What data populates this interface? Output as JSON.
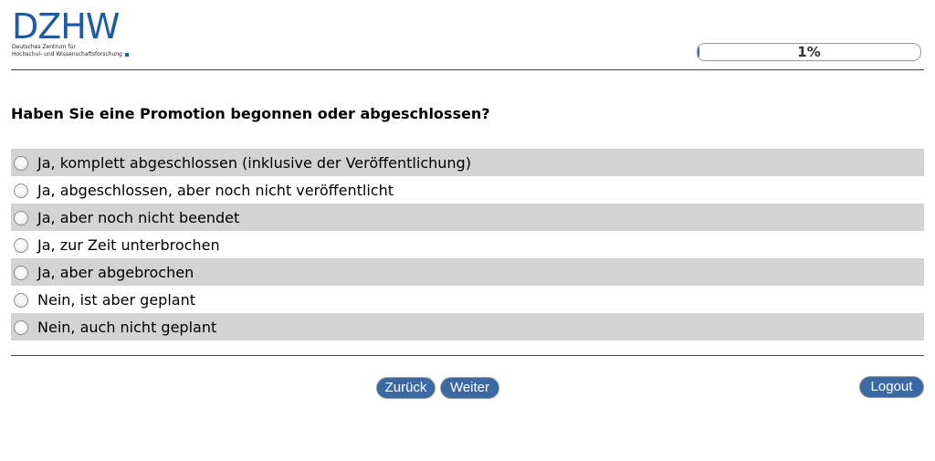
{
  "header": {
    "logo_mark": "DZHW",
    "logo_line1": "Deutsches Zentrum für",
    "logo_line2": "Hochschul- und Wissenschaftsforschung",
    "progress_text": "1%",
    "progress_fraction": 0.01
  },
  "question": {
    "text": "Haben Sie eine Promotion begonnen oder abgeschlossen?",
    "options": [
      "Ja, komplett abgeschlossen (inklusive der Veröffentlichung)",
      "Ja, abgeschlossen, aber noch nicht veröffentlicht",
      "Ja, aber noch nicht beendet",
      "Ja, zur Zeit unterbrochen",
      "Ja, aber abgebrochen",
      "Nein, ist aber geplant",
      "Nein, auch nicht geplant"
    ]
  },
  "nav": {
    "back_label": "Zurück",
    "next_label": "Weiter",
    "logout_label": "Logout"
  },
  "colors": {
    "brand_blue": "#1f5aa8",
    "button_blue": "#3a69a4",
    "row_shade": "#d3d3d3"
  }
}
